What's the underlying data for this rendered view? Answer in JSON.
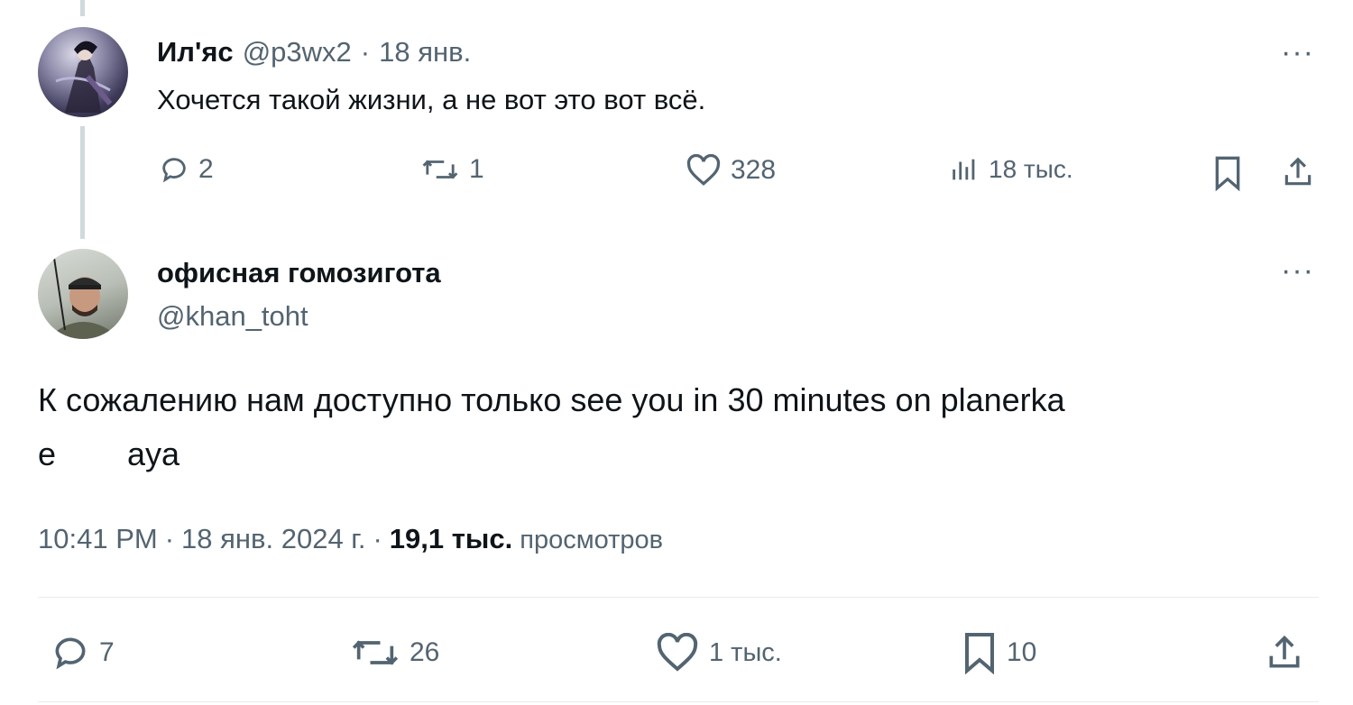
{
  "reply": {
    "name": "Ил'яс",
    "handle": "@p3wx2",
    "dot": "·",
    "date": "18 янв.",
    "text": "Хочется такой жизни, а не вот это вот всё.",
    "actions": {
      "replies": "2",
      "reposts": "1",
      "likes": "328",
      "views": "18 тыс."
    },
    "more": "···"
  },
  "main": {
    "name": "офисная гомозиготa",
    "handle": "@khan_toht",
    "more": "···",
    "text_line1": "К сожалению нам доступно только see you in 30 minutes on planerka",
    "text_line2_a": "e",
    "text_line2_b": "aya",
    "meta": {
      "time": "10:41 PM",
      "sep1": "·",
      "date": "18 янв. 2024 г.",
      "sep2": "·",
      "views_count": "19,1 тыс.",
      "views_label": "просмотров"
    },
    "actions": {
      "replies": "7",
      "reposts": "26",
      "likes": "1 тыс.",
      "bookmarks": "10"
    }
  },
  "colors": {
    "text": "#0f1419",
    "muted": "#536471",
    "thread_line": "#cfd9de",
    "divider": "#e6ecf0"
  }
}
